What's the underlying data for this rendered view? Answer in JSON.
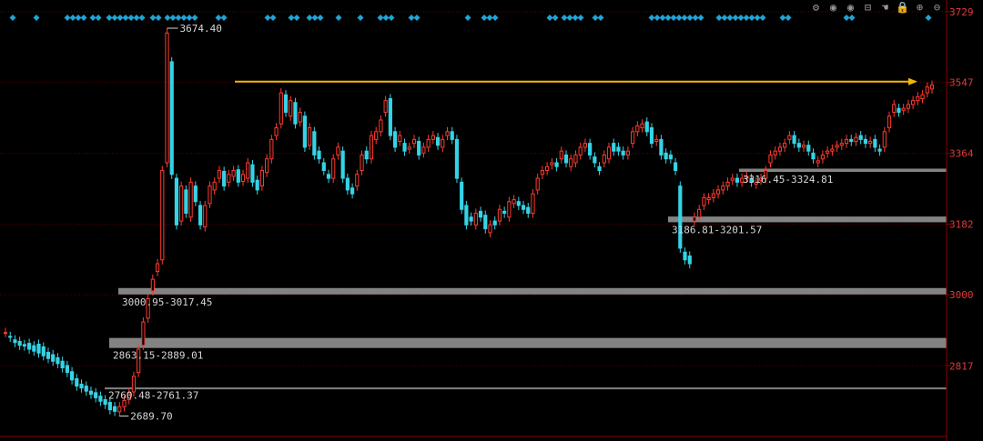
{
  "toolbar": {
    "icons": [
      "settings-icon",
      "eye-icon",
      "eye-icon",
      "basket-icon",
      "hand-icon",
      "lock-icon",
      "zoom-in-icon",
      "zoom-out-icon"
    ],
    "glyphs": [
      "⚙",
      "◉",
      "◉",
      "⊟",
      "☚",
      "🔒",
      "⊕",
      "⊖"
    ]
  },
  "colors": {
    "background": "#000000",
    "up": "#ff3b30",
    "down": "#35d3e6",
    "axis_label": "#e03a3a",
    "gridline": "#5a0000",
    "zone": "#9a9a9a",
    "arrow": "#f2b705",
    "diamond": "#1fa4d6"
  },
  "chart_data": {
    "type": "candlestick",
    "y_ticks": [
      3729,
      3547,
      3364,
      3182,
      3000,
      2817
    ],
    "ylim": [
      2640,
      3745
    ],
    "labels": {
      "high": "3674.40",
      "low": "2689.70"
    },
    "zones": [
      {
        "label": "3316.45-3324.81",
        "low": 3316.45,
        "high": 3324.81
      },
      {
        "label": "3186.81-3201.57",
        "low": 3186.81,
        "high": 3201.57
      },
      {
        "label": "3000.95-3017.45",
        "low": 3000.95,
        "high": 3017.45
      },
      {
        "label": "2863.15-2889.01",
        "low": 2863.15,
        "high": 2889.01
      },
      {
        "label": "2760.48-2761.37",
        "low": 2760.48,
        "high": 2761.37
      }
    ],
    "trend_arrow": {
      "value": 3549,
      "direction": "right"
    },
    "path": [
      [
        2903,
        2903
      ],
      [
        2893,
        2891
      ],
      [
        2884,
        2877
      ],
      [
        2880,
        2870
      ],
      [
        2872,
        2868
      ],
      [
        2875,
        2860
      ],
      [
        2869,
        2855
      ],
      [
        2873,
        2850
      ],
      [
        2866,
        2843
      ],
      [
        2852,
        2836
      ],
      [
        2846,
        2829
      ],
      [
        2838,
        2823
      ],
      [
        2829,
        2812
      ],
      [
        2818,
        2800
      ],
      [
        2802,
        2781
      ],
      [
        2784,
        2765
      ],
      [
        2770,
        2760
      ],
      [
        2765,
        2752
      ],
      [
        2752,
        2744
      ],
      [
        2748,
        2735
      ],
      [
        2739,
        2726
      ],
      [
        2730,
        2718
      ],
      [
        2723,
        2704
      ],
      [
        2712,
        2700
      ],
      [
        2699,
        2712
      ],
      [
        2712,
        2728
      ],
      [
        2730,
        2748
      ],
      [
        2750,
        2790
      ],
      [
        2800,
        2860
      ],
      [
        2870,
        2930
      ],
      [
        2940,
        2990
      ],
      [
        3010,
        3040
      ],
      [
        3060,
        3080
      ],
      [
        3090,
        3320
      ],
      [
        3340,
        3674
      ],
      [
        3600,
        3310
      ],
      [
        3300,
        3180
      ],
      [
        3190,
        3280
      ],
      [
        3270,
        3210
      ],
      [
        3200,
        3290
      ],
      [
        3280,
        3240
      ],
      [
        3230,
        3180
      ],
      [
        3175,
        3230
      ],
      [
        3235,
        3280
      ],
      [
        3270,
        3290
      ],
      [
        3300,
        3320
      ],
      [
        3318,
        3280
      ],
      [
        3290,
        3310
      ],
      [
        3305,
        3320
      ],
      [
        3322,
        3290
      ],
      [
        3292,
        3310
      ],
      [
        3300,
        3340
      ],
      [
        3335,
        3290
      ],
      [
        3295,
        3270
      ],
      [
        3280,
        3320
      ],
      [
        3315,
        3350
      ],
      [
        3350,
        3400
      ],
      [
        3410,
        3430
      ],
      [
        3440,
        3520
      ],
      [
        3515,
        3470
      ],
      [
        3460,
        3500
      ],
      [
        3495,
        3440
      ],
      [
        3445,
        3470
      ],
      [
        3460,
        3380
      ],
      [
        3385,
        3430
      ],
      [
        3420,
        3360
      ],
      [
        3370,
        3350
      ],
      [
        3340,
        3320
      ],
      [
        3310,
        3300
      ],
      [
        3300,
        3350
      ],
      [
        3360,
        3380
      ],
      [
        3370,
        3300
      ],
      [
        3300,
        3270
      ],
      [
        3275,
        3260
      ],
      [
        3280,
        3310
      ],
      [
        3320,
        3360
      ],
      [
        3370,
        3350
      ],
      [
        3350,
        3410
      ],
      [
        3400,
        3420
      ],
      [
        3420,
        3450
      ],
      [
        3470,
        3500
      ],
      [
        3505,
        3410
      ],
      [
        3420,
        3380
      ],
      [
        3395,
        3410
      ],
      [
        3390,
        3370
      ],
      [
        3375,
        3380
      ],
      [
        3390,
        3400
      ],
      [
        3395,
        3360
      ],
      [
        3365,
        3380
      ],
      [
        3380,
        3400
      ],
      [
        3400,
        3410
      ],
      [
        3405,
        3385
      ],
      [
        3380,
        3400
      ],
      [
        3410,
        3420
      ],
      [
        3420,
        3400
      ],
      [
        3400,
        3300
      ],
      [
        3290,
        3220
      ],
      [
        3230,
        3180
      ],
      [
        3200,
        3190
      ],
      [
        3180,
        3210
      ],
      [
        3215,
        3200
      ],
      [
        3205,
        3170
      ],
      [
        3160,
        3180
      ],
      [
        3190,
        3180
      ],
      [
        3190,
        3220
      ],
      [
        3215,
        3210
      ],
      [
        3200,
        3240
      ],
      [
        3235,
        3245
      ],
      [
        3240,
        3230
      ],
      [
        3230,
        3220
      ],
      [
        3225,
        3210
      ],
      [
        3210,
        3260
      ],
      [
        3270,
        3300
      ],
      [
        3310,
        3320
      ],
      [
        3320,
        3330
      ],
      [
        3335,
        3340
      ],
      [
        3340,
        3330
      ],
      [
        3350,
        3370
      ],
      [
        3360,
        3340
      ],
      [
        3330,
        3350
      ],
      [
        3340,
        3360
      ],
      [
        3360,
        3380
      ],
      [
        3380,
        3390
      ],
      [
        3390,
        3360
      ],
      [
        3355,
        3340
      ],
      [
        3330,
        3320
      ],
      [
        3340,
        3360
      ],
      [
        3350,
        3380
      ],
      [
        3390,
        3370
      ],
      [
        3380,
        3370
      ],
      [
        3370,
        3360
      ],
      [
        3360,
        3370
      ],
      [
        3390,
        3420
      ],
      [
        3420,
        3435
      ],
      [
        3430,
        3440
      ],
      [
        3445,
        3420
      ],
      [
        3430,
        3390
      ],
      [
        3395,
        3400
      ],
      [
        3400,
        3360
      ],
      [
        3365,
        3350
      ],
      [
        3360,
        3350
      ],
      [
        3340,
        3320
      ],
      [
        3280,
        3120
      ],
      [
        3110,
        3090
      ],
      [
        3100,
        3080
      ],
      [
        3190,
        3200
      ],
      [
        3200,
        3220
      ],
      [
        3230,
        3250
      ],
      [
        3245,
        3250
      ],
      [
        3250,
        3260
      ],
      [
        3260,
        3270
      ],
      [
        3270,
        3280
      ],
      [
        3280,
        3290
      ],
      [
        3295,
        3300
      ],
      [
        3300,
        3290
      ],
      [
        3290,
        3300
      ],
      [
        3300,
        3305
      ],
      [
        3300,
        3290
      ],
      [
        3285,
        3290
      ],
      [
        3295,
        3300
      ],
      [
        3300,
        3320
      ],
      [
        3340,
        3360
      ],
      [
        3360,
        3370
      ],
      [
        3370,
        3380
      ],
      [
        3380,
        3390
      ],
      [
        3400,
        3410
      ],
      [
        3410,
        3390
      ],
      [
        3390,
        3380
      ],
      [
        3380,
        3385
      ],
      [
        3385,
        3370
      ],
      [
        3365,
        3350
      ],
      [
        3340,
        3345
      ],
      [
        3350,
        3360
      ],
      [
        3365,
        3370
      ],
      [
        3370,
        3375
      ],
      [
        3380,
        3385
      ],
      [
        3385,
        3390
      ],
      [
        3390,
        3400
      ],
      [
        3400,
        3395
      ],
      [
        3395,
        3405
      ],
      [
        3410,
        3400
      ],
      [
        3400,
        3390
      ],
      [
        3390,
        3395
      ],
      [
        3400,
        3380
      ],
      [
        3375,
        3370
      ],
      [
        3380,
        3420
      ],
      [
        3430,
        3460
      ],
      [
        3470,
        3490
      ],
      [
        3480,
        3470
      ],
      [
        3475,
        3480
      ],
      [
        3480,
        3490
      ],
      [
        3490,
        3500
      ],
      [
        3500,
        3510
      ],
      [
        3505,
        3515
      ],
      [
        3520,
        3535
      ],
      [
        3530,
        3540
      ]
    ],
    "signal_markers": [
      12,
      17,
      21,
      25,
      26,
      28,
      29,
      31,
      33,
      35,
      37,
      39,
      41,
      43,
      45,
      47,
      49,
      51,
      53,
      55,
      57,
      59,
      61,
      63,
      65,
      67,
      69,
      71,
      73,
      75,
      77,
      79,
      81,
      83,
      85,
      87,
      89,
      91,
      93,
      95,
      97,
      99,
      101,
      103,
      105
    ]
  }
}
